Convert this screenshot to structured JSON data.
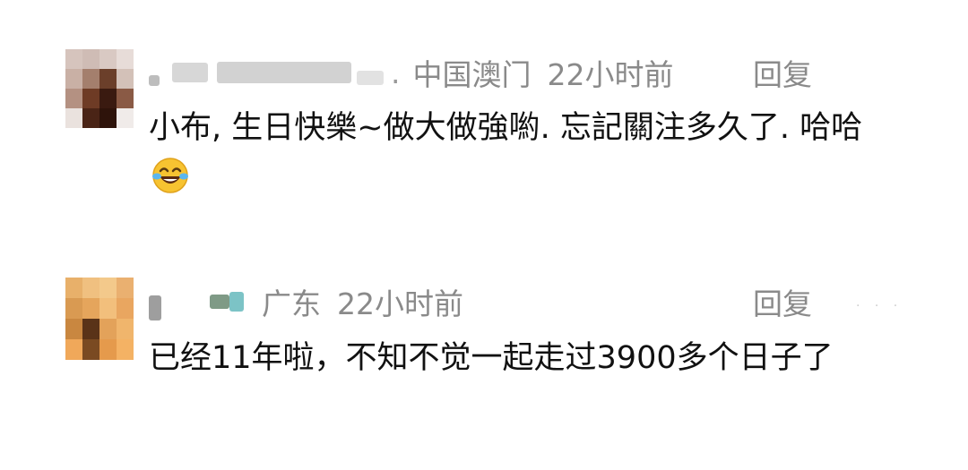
{
  "comments": [
    {
      "location": "中国澳门",
      "time": "22小时前",
      "reply_label": "回复",
      "text": "小布, 生日快樂~做大做強喲. 忘記關注多久了. 哈哈",
      "emoji": "laughing-tears-icon"
    },
    {
      "location": "广东",
      "time": "22小时前",
      "reply_label": "回复",
      "text": "已经11年啦，不知不觉一起走过3900多个日子了"
    }
  ],
  "colors": {
    "meta_text": "#8a8a8a",
    "body_text": "#111111",
    "background": "#ffffff"
  }
}
